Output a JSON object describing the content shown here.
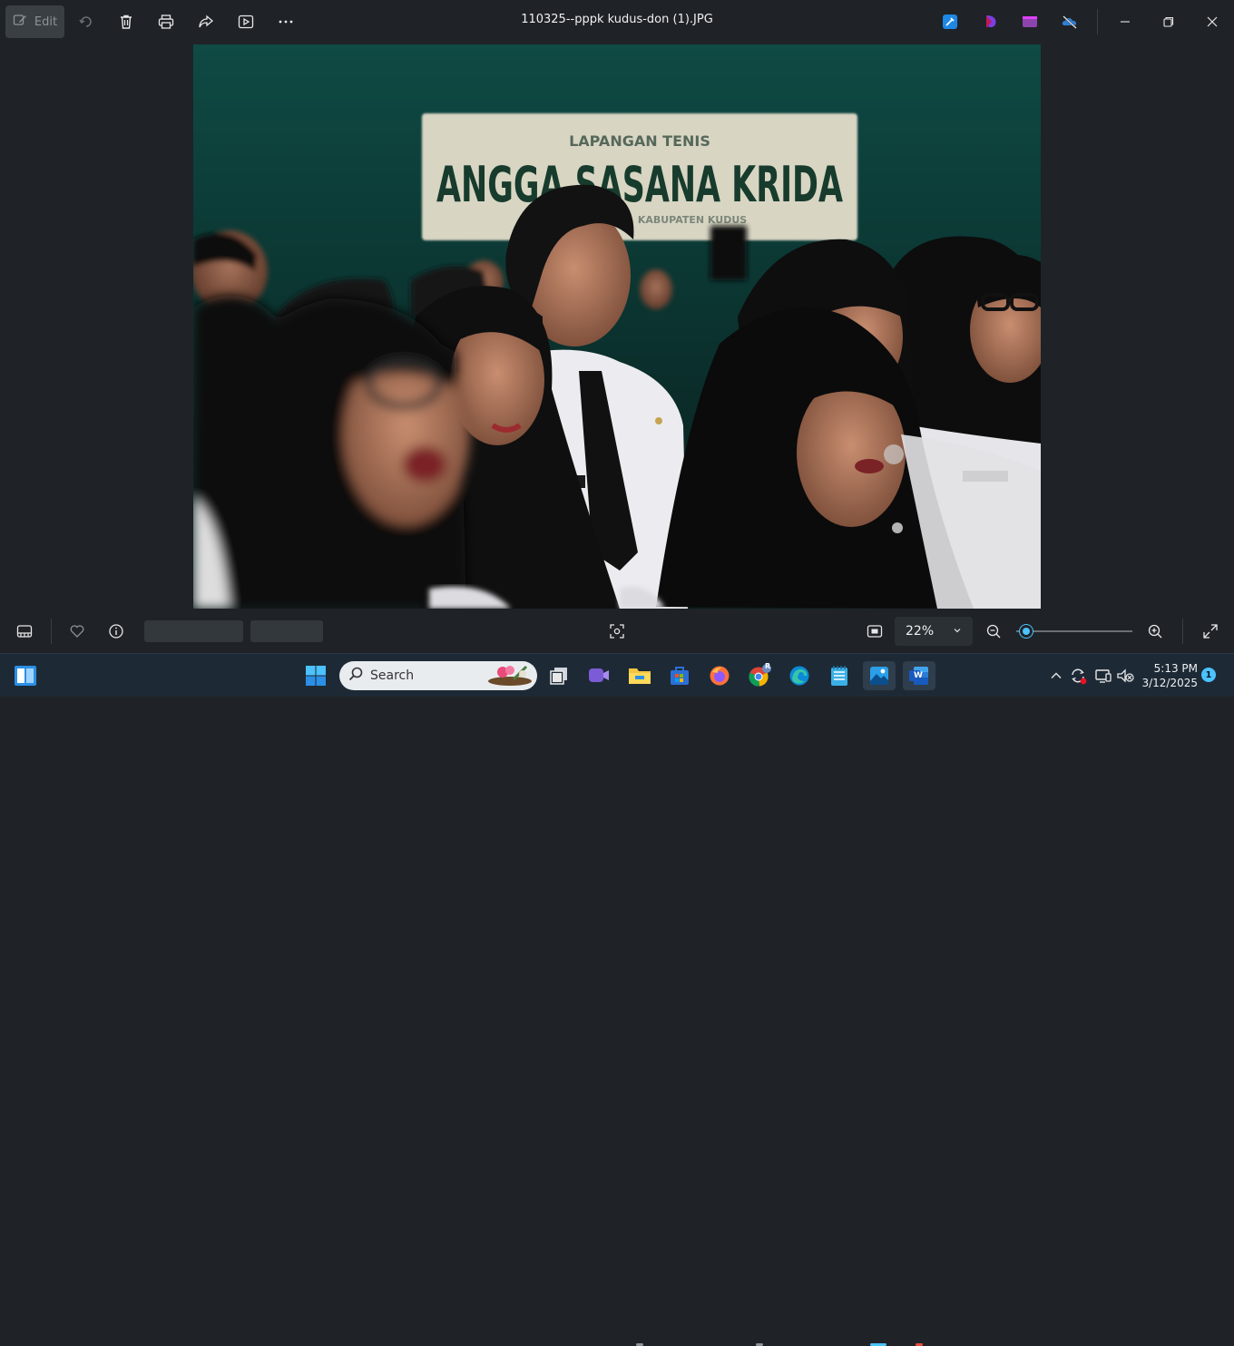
{
  "window": {
    "title": "110325--pppk kudus-don  (1).JPG"
  },
  "toolbar": {
    "edit_label": "Edit",
    "icons": [
      "edit-icon",
      "rotate-icon",
      "delete-icon",
      "print-icon",
      "share-icon",
      "slideshow-icon",
      "more-icon"
    ],
    "app_icons": [
      "designer-icon",
      "clipchamp-icon",
      "video-editor-icon",
      "onedrive-off-icon"
    ]
  },
  "photo": {
    "sign_top": "LAPANGAN TENIS",
    "sign_main": "ANGGA SASANA KRIDA",
    "sign_bottom": "KABUPATEN KUDUS"
  },
  "bottombar": {
    "zoom_value": "22%",
    "zoom_level": 0.22
  },
  "taskbar": {
    "search_placeholder": "Search",
    "time": "5:13 PM",
    "date": "3/12/2025",
    "notification_count": "1",
    "chrome_badge": "R",
    "word_letter": "W"
  },
  "colors": {
    "accent": "#4cc2ff",
    "background": "#1f2327",
    "taskbar": "#1d2a36"
  }
}
